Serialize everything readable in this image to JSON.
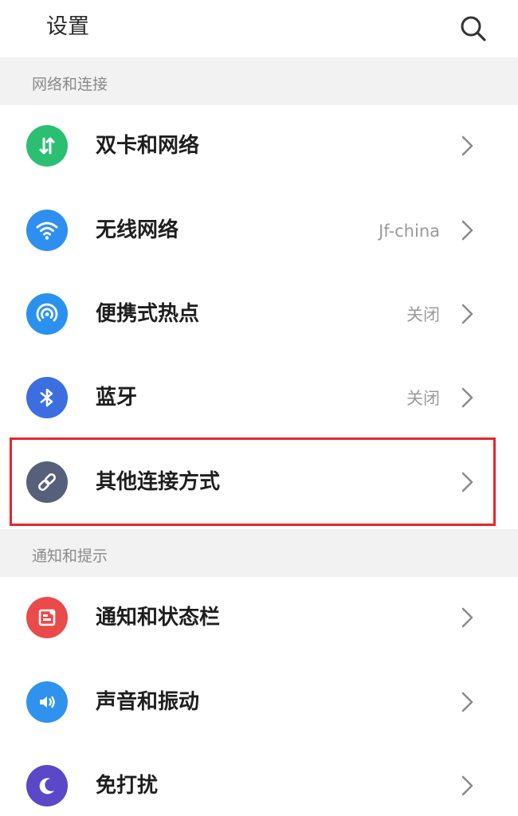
{
  "header": {
    "title": "设置",
    "search_icon": "search-icon"
  },
  "sections": [
    {
      "title": "网络和连接",
      "items": [
        {
          "label": "双卡和网络",
          "value": "",
          "icon": "dual-sim-icon",
          "color": "#2bbf72"
        },
        {
          "label": "无线网络",
          "value": "Jf-china",
          "icon": "wifi-icon",
          "color": "#2f8ff0"
        },
        {
          "label": "便携式热点",
          "value": "关闭",
          "icon": "hotspot-icon",
          "color": "#2a92ee"
        },
        {
          "label": "蓝牙",
          "value": "关闭",
          "icon": "bluetooth-icon",
          "color": "#3b6fe0"
        },
        {
          "label": "其他连接方式",
          "value": "",
          "icon": "link-icon",
          "color": "#56607a"
        }
      ]
    },
    {
      "title": "通知和提示",
      "items": [
        {
          "label": "通知和状态栏",
          "value": "",
          "icon": "notification-icon",
          "color": "#ea4a4a"
        },
        {
          "label": "声音和振动",
          "value": "",
          "icon": "sound-icon",
          "color": "#2f93ee"
        },
        {
          "label": "免打扰",
          "value": "",
          "icon": "moon-icon",
          "color": "#5a48c8"
        }
      ]
    }
  ],
  "highlight_color": "#e8252b"
}
